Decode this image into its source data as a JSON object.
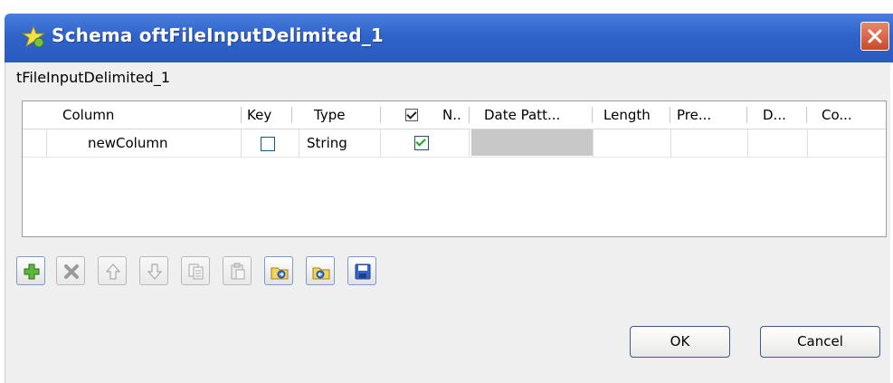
{
  "window": {
    "title": "Schema oftFileInputDelimited_1",
    "title_icon": "schema-star-icon",
    "close_icon": "close-icon"
  },
  "component_label": "tFileInputDelimited_1",
  "table": {
    "headers": {
      "column": "Column",
      "key": "Key",
      "type": "Type",
      "nullable": "N..",
      "date_pattern": "Date Patt...",
      "length": "Length",
      "precision": "Pre...",
      "default": "D...",
      "comment": "Co..."
    },
    "header_nullable_checked": true,
    "rows": [
      {
        "column": "newColumn",
        "key": false,
        "type": "String",
        "nullable": true,
        "date_pattern": "",
        "length": "",
        "precision": "",
        "default": "",
        "comment": ""
      }
    ]
  },
  "toolbar": {
    "buttons": [
      {
        "name": "add-button",
        "icon": "plus-icon",
        "enabled": true
      },
      {
        "name": "remove-button",
        "icon": "x-icon",
        "enabled": false
      },
      {
        "name": "move-up-button",
        "icon": "arrow-up-icon",
        "enabled": false
      },
      {
        "name": "move-down-button",
        "icon": "arrow-down-icon",
        "enabled": false
      },
      {
        "name": "copy-button",
        "icon": "copy-icon",
        "enabled": false
      },
      {
        "name": "paste-button",
        "icon": "paste-icon",
        "enabled": false
      },
      {
        "name": "import-button",
        "icon": "import-icon",
        "enabled": true
      },
      {
        "name": "export-button",
        "icon": "export-icon",
        "enabled": true
      },
      {
        "name": "save-button",
        "icon": "save-icon",
        "enabled": true
      }
    ]
  },
  "buttons": {
    "ok": "OK",
    "cancel": "Cancel"
  },
  "colors": {
    "titlebar": "#2f63c9",
    "close": "#c94a2a",
    "check": "#21a121"
  }
}
